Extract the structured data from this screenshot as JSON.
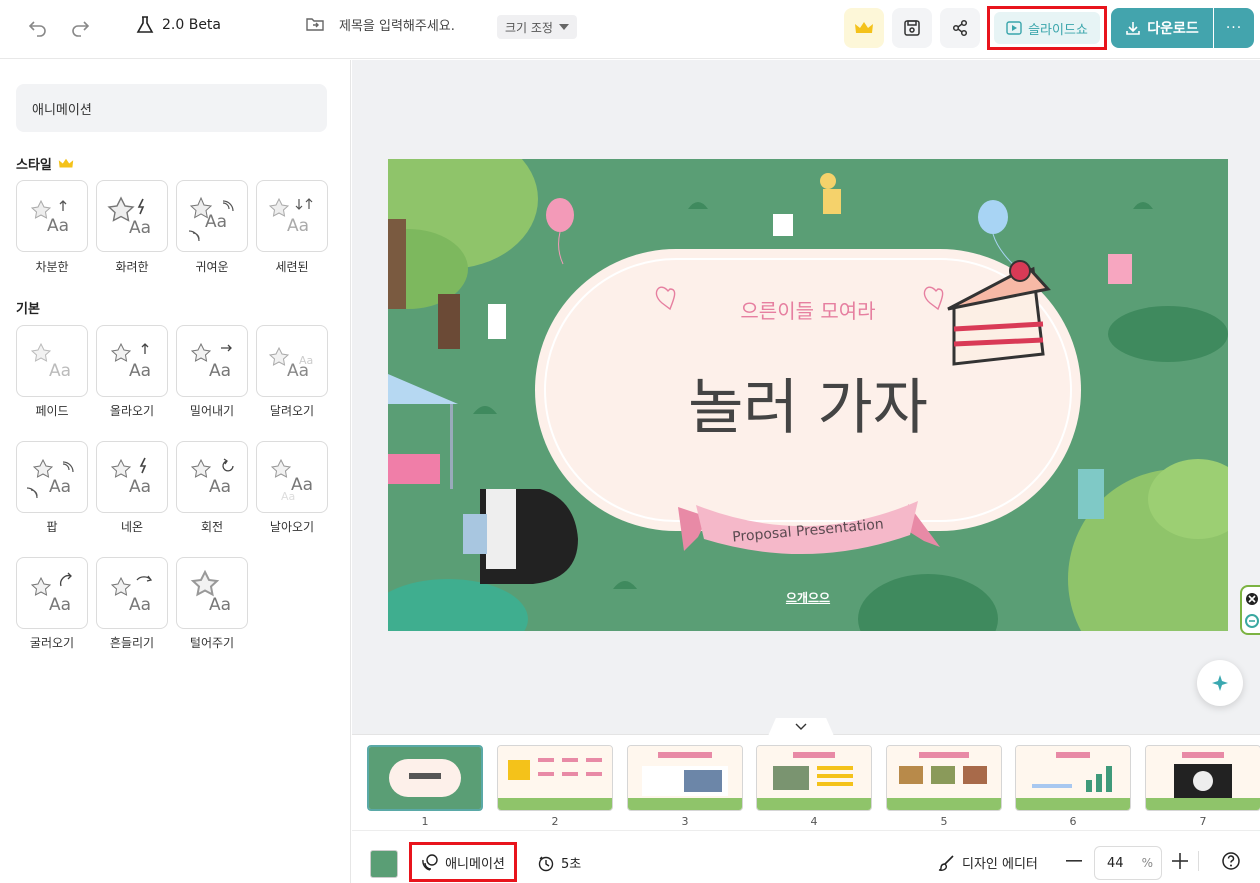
{
  "topbar": {
    "version_label": "2.0 Beta",
    "title_placeholder": "제목을 입력해주세요.",
    "resize_label": "크기 조정",
    "slideshow_label": "슬라이드쇼",
    "download_label": "다운로드",
    "more_label": "···"
  },
  "panel": {
    "header": "애니메이션",
    "style_section": "스타일",
    "style_items": [
      "차분한",
      "화려한",
      "귀여운",
      "세련된"
    ],
    "basic_section": "기본",
    "basic_items": [
      "페이드",
      "올라오기",
      "밀어내기",
      "달려오기",
      "팝",
      "네온",
      "회전",
      "날아오기",
      "굴러오기",
      "흔들리기",
      "털어주기"
    ]
  },
  "slide": {
    "subtitle": "으른이들 모여라",
    "title": "놀러 가자",
    "ribbon": "Proposal Presentation",
    "footer": "으개으으"
  },
  "thumbnails": {
    "numbers": [
      "1",
      "2",
      "3",
      "4",
      "5",
      "6",
      "7"
    ],
    "active_index": 0
  },
  "bottombar": {
    "animation_label": "애니메이션",
    "timer_label": "5초",
    "design_editor_label": "디자인 에디터",
    "zoom_value": "44",
    "zoom_unit": "%"
  },
  "colors": {
    "accent_teal": "#43a4ad",
    "highlight_red": "#e8141c",
    "slide_green": "#5a9e75",
    "ribbon_pink": "#e88aa6"
  }
}
